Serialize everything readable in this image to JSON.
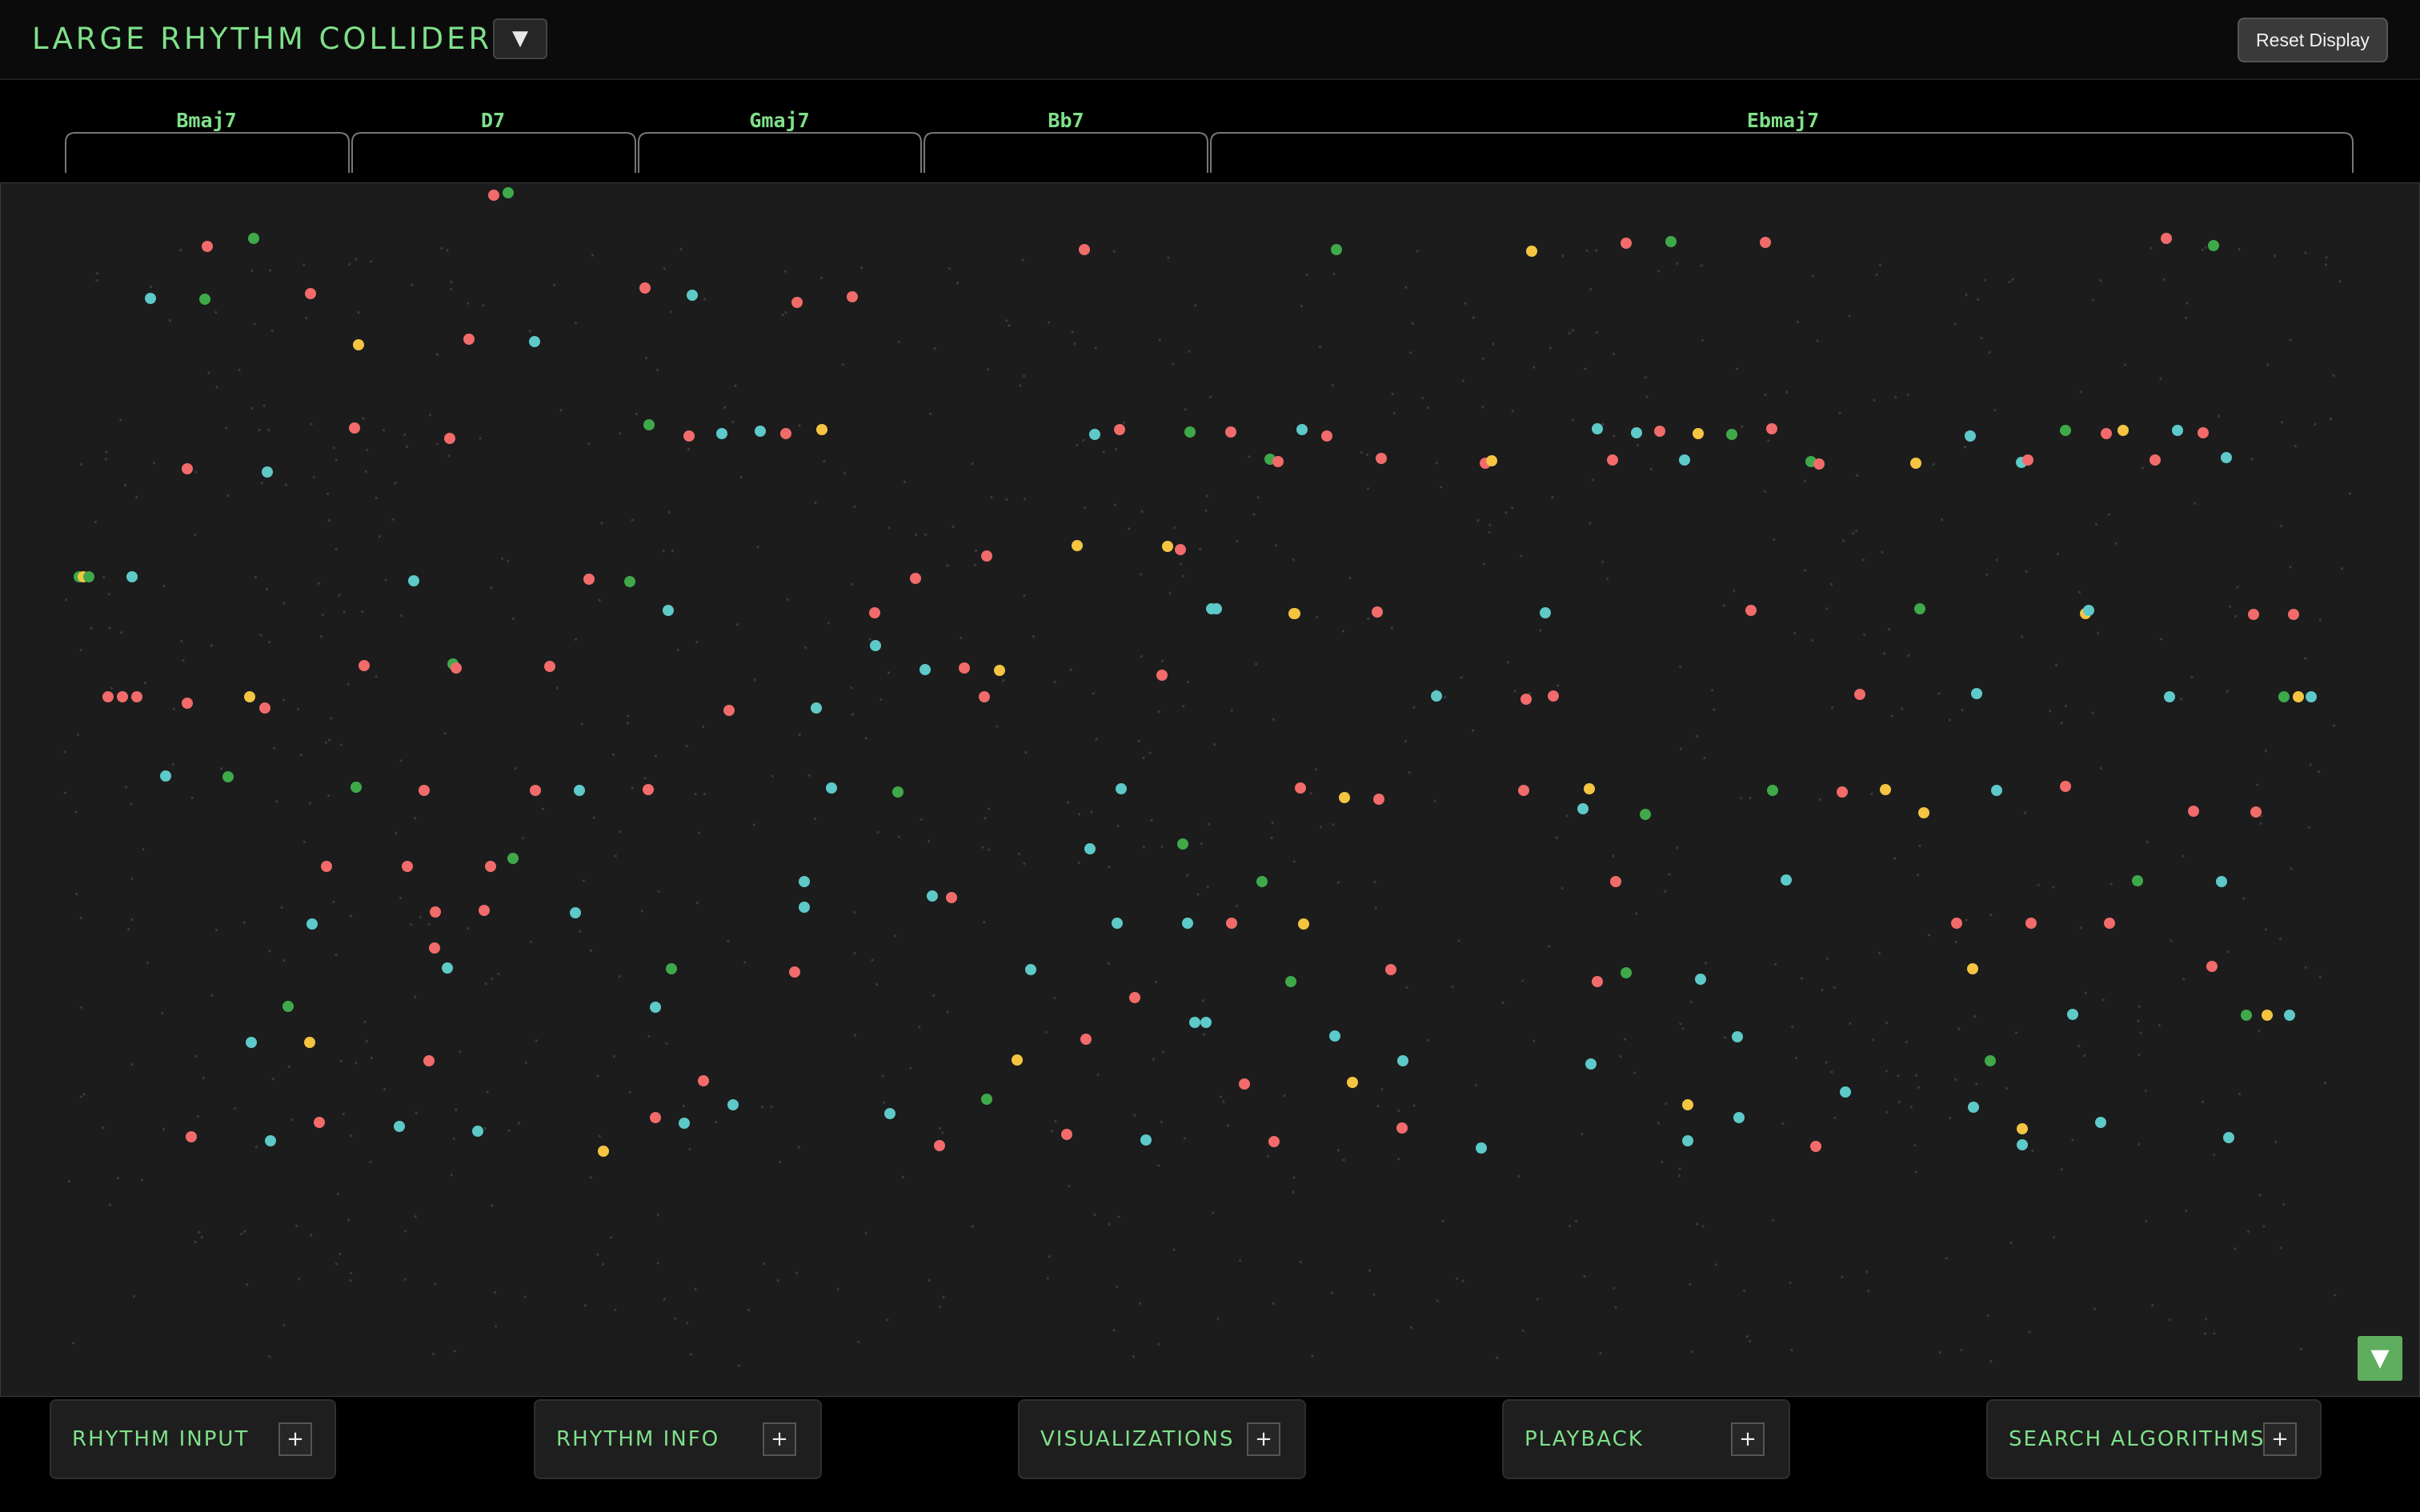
{
  "header": {
    "title": "LARGE RHYTHM COLLIDER",
    "menu_toggle_icon": "▼",
    "reset_label": "Reset Display"
  },
  "chords": [
    {
      "name": "Bmaj7"
    },
    {
      "name": "D7"
    },
    {
      "name": "Gmaj7"
    },
    {
      "name": "Bb7"
    },
    {
      "name": "Ebmaj7"
    }
  ],
  "colors": {
    "accent_green": "#7fe08a",
    "dot_red": "#f26b6b",
    "dot_cyan": "#5ec9c9",
    "dot_green": "#3fa94a",
    "dot_yellow": "#f5c542",
    "canvas_bg": "#1c1c1c"
  },
  "canvas": {
    "collapse_icon": "▼"
  },
  "panels": [
    {
      "label": "RHYTHM INPUT",
      "icon": "+"
    },
    {
      "label": "RHYTHM INFO",
      "icon": "+"
    },
    {
      "label": "VISUALIZATIONS",
      "icon": "+"
    },
    {
      "label": "PLAYBACK",
      "icon": "+"
    },
    {
      "label": "SEARCH ALGORITHMS",
      "icon": "+"
    }
  ]
}
